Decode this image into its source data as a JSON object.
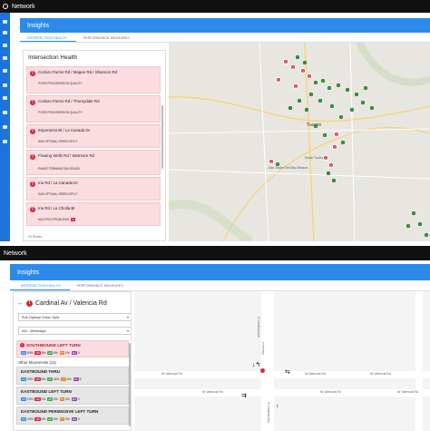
{
  "top": {
    "app_title": "Network",
    "header_title": "Insights",
    "tabs": [
      "INTERSECTION HEALTH",
      "PERFORMANCE MEASURES"
    ],
    "panel_title": "Intersection Health",
    "cards": [
      {
        "name": "Cortaro Farms Rd / Magee Rd / Shannon Rd",
        "status": "POOR PROGRESSION QUALITY",
        "status2": ""
      },
      {
        "name": "Cortaro Farms Rd / Thornydale Rd",
        "status": "POOR PROGRESSION QUALITY",
        "status2": ""
      },
      {
        "name": "Esperanza Bl / La Canada Dr",
        "status": "SUB OPTIMAL GREEN SPLIT",
        "status2": ""
      },
      {
        "name": "Flowing Wells Rd / Wetmore Rd",
        "status": "PHASE TERMINATION ISSUES",
        "status2": ""
      },
      {
        "name": "Ina Rd / La Canada Dr",
        "status": "SUB OPTIMAL GREEN SPLIT",
        "status2": ""
      },
      {
        "name": "Ina Rd / La Cholla Bl",
        "status": "MULTIPLE PROBLEMS",
        "status2": "",
        "badge": "3"
      }
    ],
    "footer_text": "25 Roads",
    "map_labels": [
      "Tucson",
      "South Tucson",
      "San Xavier Del Bac Mission"
    ]
  },
  "bottom": {
    "app_title": "Network",
    "header_title": "Insights",
    "tabs": [
      "INTERSECTION HEALTH",
      "PERFORMANCE MEASURES"
    ],
    "intersection_title": "Cardinal Av / Valencia Rd",
    "select_problem": "Sub Optimal Green Split",
    "select_time": "AM - Weekdays",
    "flagged": {
      "name": "SOUTHBOUND LEFT TURN",
      "metrics": [
        {
          "key": "SG",
          "value": "54%",
          "color": "#2c8bea"
        },
        {
          "key": "OR",
          "value": "8%",
          "color": "#d7263d"
        },
        {
          "key": "AP",
          "value": "6%",
          "color": "#3aa845"
        },
        {
          "key": "PT",
          "value": "0%",
          "color": "#e67e22"
        },
        {
          "key": "MA",
          "value": "0",
          "color": "#8e44ad"
        }
      ]
    },
    "other_header": "Other Movements (13)",
    "movements": [
      {
        "name": "EASTBOUND THRU",
        "metrics": [
          {
            "key": "SG",
            "value": "29%",
            "color": "#2c8bea"
          },
          {
            "key": "OR",
            "value": "8%",
            "color": "#d7263d"
          },
          {
            "key": "AP",
            "value": "34%",
            "color": "#3aa845"
          },
          {
            "key": "PT",
            "value": "0%",
            "color": "#e67e22"
          },
          {
            "key": "MA",
            "value": "0",
            "color": "#8e44ad"
          }
        ]
      },
      {
        "name": "EASTBOUND LEFT TURN",
        "metrics": [
          {
            "key": "SG",
            "value": "10%",
            "color": "#2c8bea"
          },
          {
            "key": "OR",
            "value": "0%",
            "color": "#d7263d"
          },
          {
            "key": "AP",
            "value": "0%",
            "color": "#3aa845"
          },
          {
            "key": "PT",
            "value": "0%",
            "color": "#e67e22"
          },
          {
            "key": "MA",
            "value": "0",
            "color": "#8e44ad"
          }
        ]
      },
      {
        "name": "EASTBOUND PERMISSIVE LEFT TURN",
        "metrics": [
          {
            "key": "SG",
            "value": "20%",
            "color": "#2c8bea"
          },
          {
            "key": "OR",
            "value": "0%",
            "color": "#d7263d"
          },
          {
            "key": "AP",
            "value": "0%",
            "color": "#3aa845"
          },
          {
            "key": "PT",
            "value": "0%",
            "color": "#e67e22"
          },
          {
            "key": "MA",
            "value": "0",
            "color": "#8e44ad"
          }
        ]
      }
    ],
    "road_labels": [
      "W Valencia Rd",
      "W Valencia Rd",
      "W Valencia Rd",
      "W Valencia Rd",
      "W Valencia Rd",
      "W Valencia Rd",
      "S Cardinal Ave",
      "S Cardinal Ave",
      "Walgreens"
    ]
  },
  "colors": {
    "primary": "#2c8bea",
    "alert": "#d7263d",
    "ok": "#3aa845",
    "rail": "#1e73d8"
  }
}
